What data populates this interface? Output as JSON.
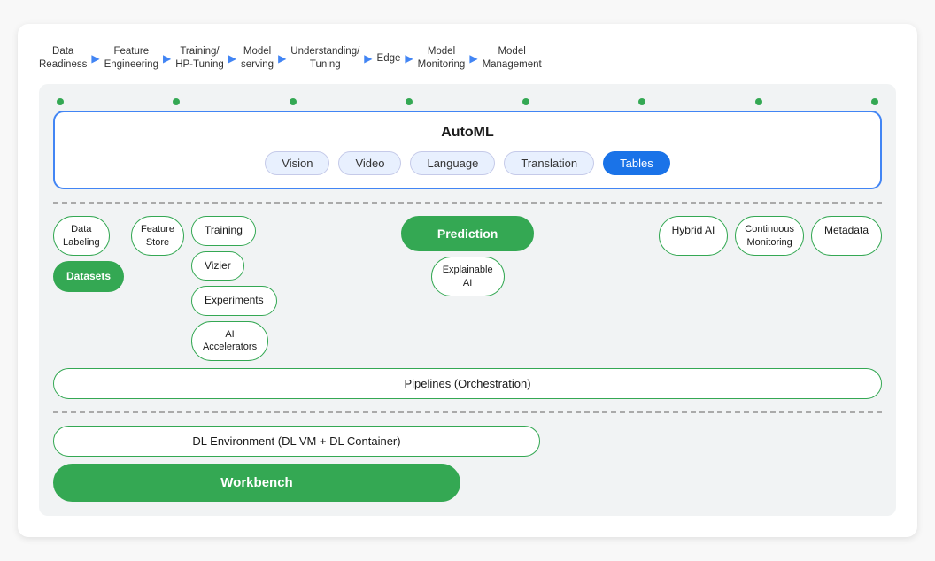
{
  "header": {
    "steps": [
      {
        "label": "Data\nReadiness"
      },
      {
        "label": "Feature\nEngineering"
      },
      {
        "label": "Training/\nHP-Tuning"
      },
      {
        "label": "Model\nserving"
      },
      {
        "label": "Understanding/\nTuning"
      },
      {
        "label": "Edge"
      },
      {
        "label": "Model\nMonitoring"
      },
      {
        "label": "Model\nManagement"
      }
    ]
  },
  "automl": {
    "title": "AutoML",
    "pills": [
      {
        "label": "Vision",
        "active": false
      },
      {
        "label": "Video",
        "active": false
      },
      {
        "label": "Language",
        "active": false
      },
      {
        "label": "Translation",
        "active": false
      },
      {
        "label": "Tables",
        "active": true
      }
    ]
  },
  "nodes": {
    "dataLabeling": "Data\nLabeling",
    "featureStore": "Feature\nStore",
    "training": "Training",
    "prediction": "Prediction",
    "hybridAI": "Hybrid AI",
    "continuousMonitoring": "Continuous\nMonitoring",
    "metadata": "Metadata",
    "datasets": "Datasets",
    "vizier": "Vizier",
    "explainableAI": "Explainable\nAI",
    "experiments": "Experiments",
    "aiAccelerators": "AI\nAccelerators",
    "pipelines": "Pipelines (Orchestration)",
    "dlEnvironment": "DL Environment (DL VM + DL Container)",
    "workbench": "Workbench"
  }
}
